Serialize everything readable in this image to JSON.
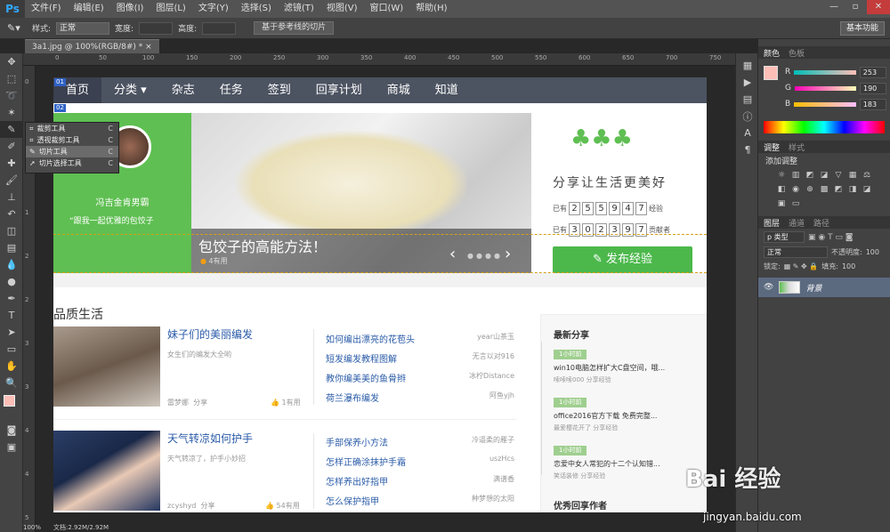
{
  "menubar": {
    "logo": "Ps",
    "items": [
      "文件(F)",
      "编辑(E)",
      "图像(I)",
      "图层(L)",
      "文字(Y)",
      "选择(S)",
      "滤镜(T)",
      "视图(V)",
      "窗口(W)",
      "帮助(H)"
    ],
    "min": "—",
    "max": "▫",
    "close": "✕"
  },
  "options": {
    "style_label": "样式:",
    "style_value": "正常",
    "width_label": "宽度:",
    "height_label": "高度:",
    "guides_button": "基于参考线的切片",
    "workspace": "基本功能"
  },
  "doc_tab": "3a1.jpg @ 100%(RGB/8#) * ×",
  "flyout": [
    {
      "label": "裁剪工具",
      "key": "C"
    },
    {
      "label": "透视裁剪工具",
      "key": "C"
    },
    {
      "label": "切片工具",
      "key": "C"
    },
    {
      "label": "切片选择工具",
      "key": "C"
    }
  ],
  "rulers": {
    "h": [
      "0",
      "50",
      "100",
      "150",
      "200",
      "250",
      "300",
      "350",
      "400",
      "450",
      "500",
      "550",
      "600",
      "650",
      "700",
      "750"
    ],
    "v": [
      "0",
      "5",
      "1",
      "1",
      "2",
      "2",
      "3",
      "3",
      "4",
      "4",
      "5"
    ]
  },
  "colors_panel": {
    "tabs": [
      "颜色",
      "色板"
    ],
    "channels": [
      {
        "name": "R",
        "value": "253"
      },
      {
        "name": "G",
        "value": "190"
      },
      {
        "name": "B",
        "value": "183"
      }
    ],
    "fg": "#fdbeb7"
  },
  "adjust_panel": {
    "tabs": [
      "调整",
      "样式"
    ],
    "title": "添加调整"
  },
  "layers_panel": {
    "tabs": [
      "图层",
      "通道",
      "路径"
    ],
    "kind": "p 类型",
    "blend": "正常",
    "opacity_label": "不透明度:",
    "opacity": "100",
    "lock_label": "锁定:",
    "fill_label": "填充:",
    "fill": "100",
    "layer_name": "背景"
  },
  "status": {
    "zoom": "100%",
    "doc": "文档:2.92M/2.92M"
  },
  "site": {
    "nav": [
      "首页",
      "分类 ▾",
      "杂志",
      "任务",
      "签到",
      "回享计划",
      "商城",
      "知道"
    ],
    "slice_tags": [
      "01",
      "02",
      "03",
      "04"
    ],
    "profile_name": "冯吉金肯男霸",
    "profile_quote": "“跟我一起优雅的包饺子",
    "hero_title": "包饺子的高能方法！",
    "hero_meta": "4有用",
    "slogan": "分享让生活更美好",
    "count1_prefix": "已有",
    "count1_digits": [
      "2",
      "5",
      "5",
      "9",
      "4",
      "7"
    ],
    "count1_suffix": "经验",
    "count2_prefix": "已有",
    "count2_digits": [
      "3",
      "0",
      "2",
      "3",
      "9",
      "7"
    ],
    "count2_suffix": "贡献者",
    "publish": "发布经验",
    "section": "品质生活",
    "articles": [
      {
        "title": "妹子们的美丽编发",
        "desc": "女生们的编发大全哟",
        "author": "雷梦娜",
        "share": "分享",
        "useful": "1有用",
        "links": [
          {
            "t": "如何编出漂亮的花苞头",
            "a": "year山茶玉"
          },
          {
            "t": "短发编发教程图解",
            "a": "无言以对916"
          },
          {
            "t": "教你编美美的鱼骨辫",
            "a": "冰柠Distance"
          },
          {
            "t": "荷兰瀑布编发",
            "a": "阿鱼yjh"
          }
        ]
      },
      {
        "title": "天气转凉如何护手",
        "desc": "天气转凉了，护手小妙招",
        "author": "zcyshyd",
        "share": "分享",
        "useful": "54有用",
        "links": [
          {
            "t": "手部保养小方法",
            "a": "冷逼柔的雁子"
          },
          {
            "t": "怎样正确涂抹护手霜",
            "a": "uszHcs"
          },
          {
            "t": "怎样养出好指甲",
            "a": "满谱香"
          },
          {
            "t": "怎么保护指甲",
            "a": "种梦想的太阳"
          }
        ]
      }
    ],
    "latest_title": "最新分享",
    "latest": [
      {
        "time": "1小时前",
        "title": "win10电脑怎样扩大C盘空间，哦...",
        "meta": "嗦嗦嗦000 分享经验"
      },
      {
        "time": "1小时前",
        "title": "office2016官方下载 免费完整...",
        "meta": "最爱樱花开了 分享经验"
      },
      {
        "time": "1小时前",
        "title": "恋爱中女人常犯的十二个认知错...",
        "meta": "笑话装修 分享经验"
      }
    ],
    "latest_more": "优秀回享作者"
  },
  "watermark": {
    "brand": "Bai 经验",
    "url": "jingyan.baidu.com"
  }
}
